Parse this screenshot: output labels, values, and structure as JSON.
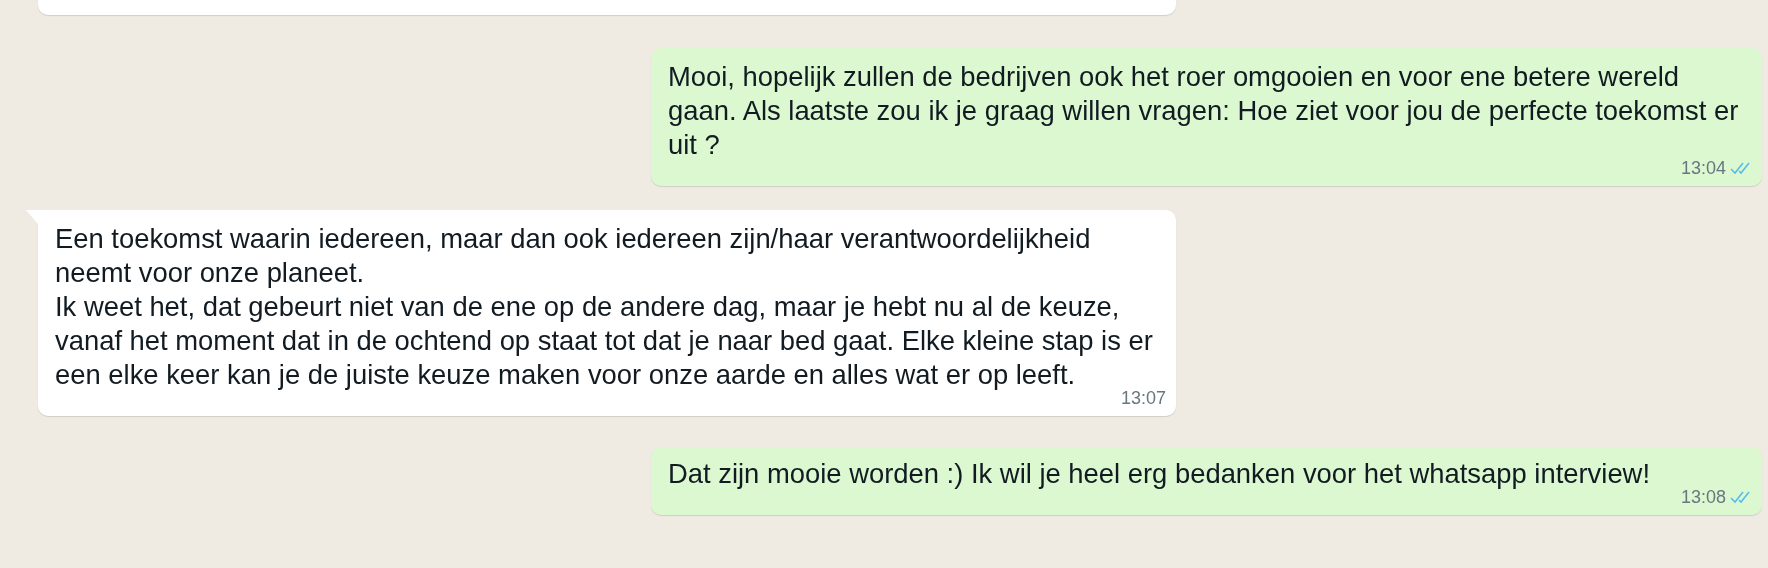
{
  "messages": [
    {
      "kind": "incoming",
      "cut": true
    },
    {
      "kind": "outgoing",
      "text": "Mooi, hopelijk zullen de bedrijven ook het roer omgooien en voor ene betere wereld gaan. Als laatste zou ik je graag willen vragen: Hoe ziet voor jou de perfecte toekomst er uit ?",
      "time": "13:04",
      "read": true
    },
    {
      "kind": "incoming",
      "text": "Een toekomst waarin iedereen, maar dan ook iedereen zijn/haar verantwoordelijkheid neemt voor onze planeet.\nIk weet het, dat gebeurt niet van de ene op de andere dag, maar je hebt nu al de keuze, vanaf het moment dat in de ochtend op staat tot dat je naar bed gaat. Elke kleine stap is er een elke keer kan je de juiste keuze maken voor onze aarde en alles wat er op leeft.",
      "time": "13:07",
      "tail": true
    },
    {
      "kind": "outgoing",
      "text": "Dat zijn mooie worden :) Ik wil je heel erg bedanken voor het whatsapp interview!",
      "time": "13:08",
      "read": true
    }
  ]
}
